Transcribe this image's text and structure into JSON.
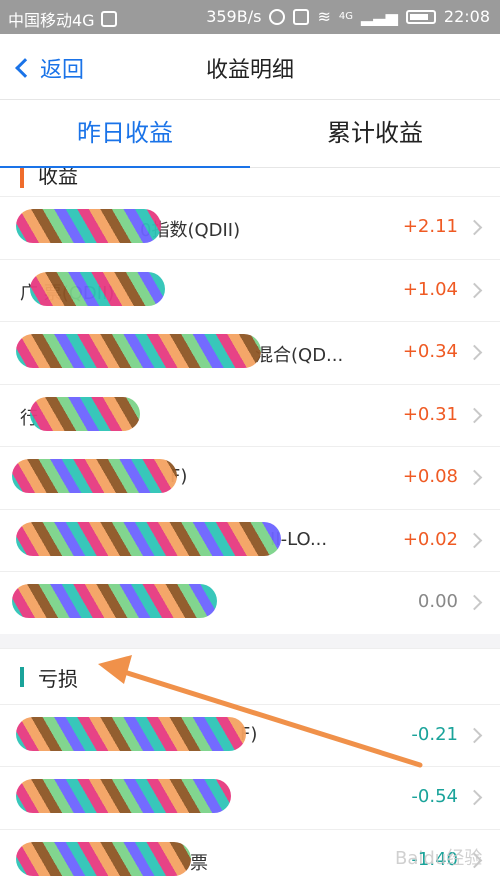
{
  "status_bar": {
    "carrier": "中国移动4G",
    "speed": "359B/s",
    "network": "4G",
    "time": "22:08"
  },
  "navbar": {
    "back_label": "返回",
    "title": "收益明细"
  },
  "tabs": [
    {
      "label": "昨日收益",
      "active": true
    },
    {
      "label": "累计收益",
      "active": false
    }
  ],
  "gain_section": {
    "title": "收益",
    "accent": "#ef6c2c",
    "rows": [
      {
        "name": "0指数(QDII)",
        "value": "+2.11"
      },
      {
        "name": "广 票(QDII)",
        "value": "+1.04"
      },
      {
        "name": "混合(QD...",
        "value": "+0.34"
      },
      {
        "name": "行",
        "value": "+0.31"
      },
      {
        "name": "F)",
        "value": "+0.08"
      },
      {
        "name": "II-LO...",
        "value": "+0.02"
      },
      {
        "name": "",
        "value": "0.00"
      }
    ]
  },
  "loss_section": {
    "title": "亏损",
    "accent": "#1aa39a",
    "rows": [
      {
        "name": "F)",
        "value": "-0.21"
      },
      {
        "name": "",
        "value": "-0.54"
      },
      {
        "name": "票",
        "value": "-1.40"
      }
    ]
  },
  "colors": {
    "primary": "#1a73e8",
    "positive": "#ef5a23",
    "negative": "#1aa39a",
    "neutral": "#888888",
    "annotation_arrow": "#f0914a"
  },
  "watermark": "Baidu经验"
}
